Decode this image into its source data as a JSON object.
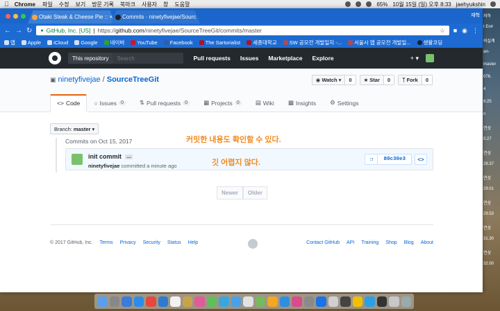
{
  "menubar": {
    "app": "Chrome",
    "items": [
      "파일",
      "수정",
      "보기",
      "방문 기록",
      "북마크",
      "사용자",
      "창",
      "도움말"
    ],
    "battery": "65%",
    "clock": "10월 15일 (일) 오후 8:33",
    "user": "jaehyukshin"
  },
  "browser": {
    "tabs": [
      {
        "label": "Otaki Steak & Cheese Pie :: ×"
      },
      {
        "label": "Commits · ninetyfivejae/Sourc ×"
      }
    ],
    "profile": "재혁",
    "url_org": "GitHub, Inc. [US]",
    "url_prefix": "https://",
    "url_host": "github.com",
    "url_path": "/ninetyfivejae/SourceTreeGit/commits/master",
    "bookmarks": [
      "앱",
      "Apple",
      "iCloud",
      "Google",
      "네이버",
      "YouTube",
      "Facebook",
      "The Sartorialist",
      "세종대학교",
      "SW 공모전 개발일지 -...",
      "서울시 앱 공모전 개발일...",
      "생활코딩"
    ]
  },
  "github": {
    "search_scope": "This repository",
    "search_placeholder": "Search",
    "nav": [
      "Pull requests",
      "Issues",
      "Marketplace",
      "Explore"
    ],
    "plus": "+ ▾",
    "owner": "ninetyfivejae",
    "repo": "SourceTreeGit",
    "watch": {
      "label": "Watch ▾",
      "count": "0"
    },
    "star": {
      "label": "Star",
      "count": "0"
    },
    "fork": {
      "label": "Fork",
      "count": "0"
    },
    "tabs": [
      {
        "label": "Code",
        "count": ""
      },
      {
        "label": "Issues",
        "count": "0"
      },
      {
        "label": "Pull requests",
        "count": "0"
      },
      {
        "label": "Projects",
        "count": "0"
      },
      {
        "label": "Wiki",
        "count": ""
      },
      {
        "label": "Insights",
        "count": ""
      },
      {
        "label": "Settings",
        "count": ""
      }
    ],
    "branch_label": "Branch:",
    "branch_name": "master ▾",
    "commits_on": "Commits on Oct 15, 2017",
    "commit": {
      "message": "init commit",
      "ellipsis": "…",
      "author": "ninetyfivejae",
      "meta_suffix": "committed a minute ago",
      "sha": "80c30e3",
      "browse": "<>"
    },
    "pager": {
      "newer": "Newer",
      "older": "Older"
    },
    "footer_copyright": "© 2017 GitHub, Inc.",
    "footer_left": [
      "Terms",
      "Privacy",
      "Security",
      "Status",
      "Help"
    ],
    "footer_right": [
      "Contact GitHub",
      "API",
      "Training",
      "Shop",
      "Blog",
      "About"
    ]
  },
  "annotations": {
    "line1": "커밋한 내용도 확인할 수 있다.",
    "line2": "깃 어렵지 않다."
  },
  "desktop_right": [
    "저하",
    "t En#",
    "의실계",
    "an-",
    "master",
    "076.",
    "4",
    "8:25",
    "n",
    "연샷",
    "5:27",
    "연샷",
    "28.37",
    "연샷",
    "29.01",
    "연샷",
    "29.53",
    "연샷",
    "31.30",
    "연샷",
    "32.00"
  ],
  "colors": {
    "accent": "#f28a1f",
    "tabbar": "#1a66cc",
    "github_header": "#24292e",
    "link": "#0366d6"
  }
}
